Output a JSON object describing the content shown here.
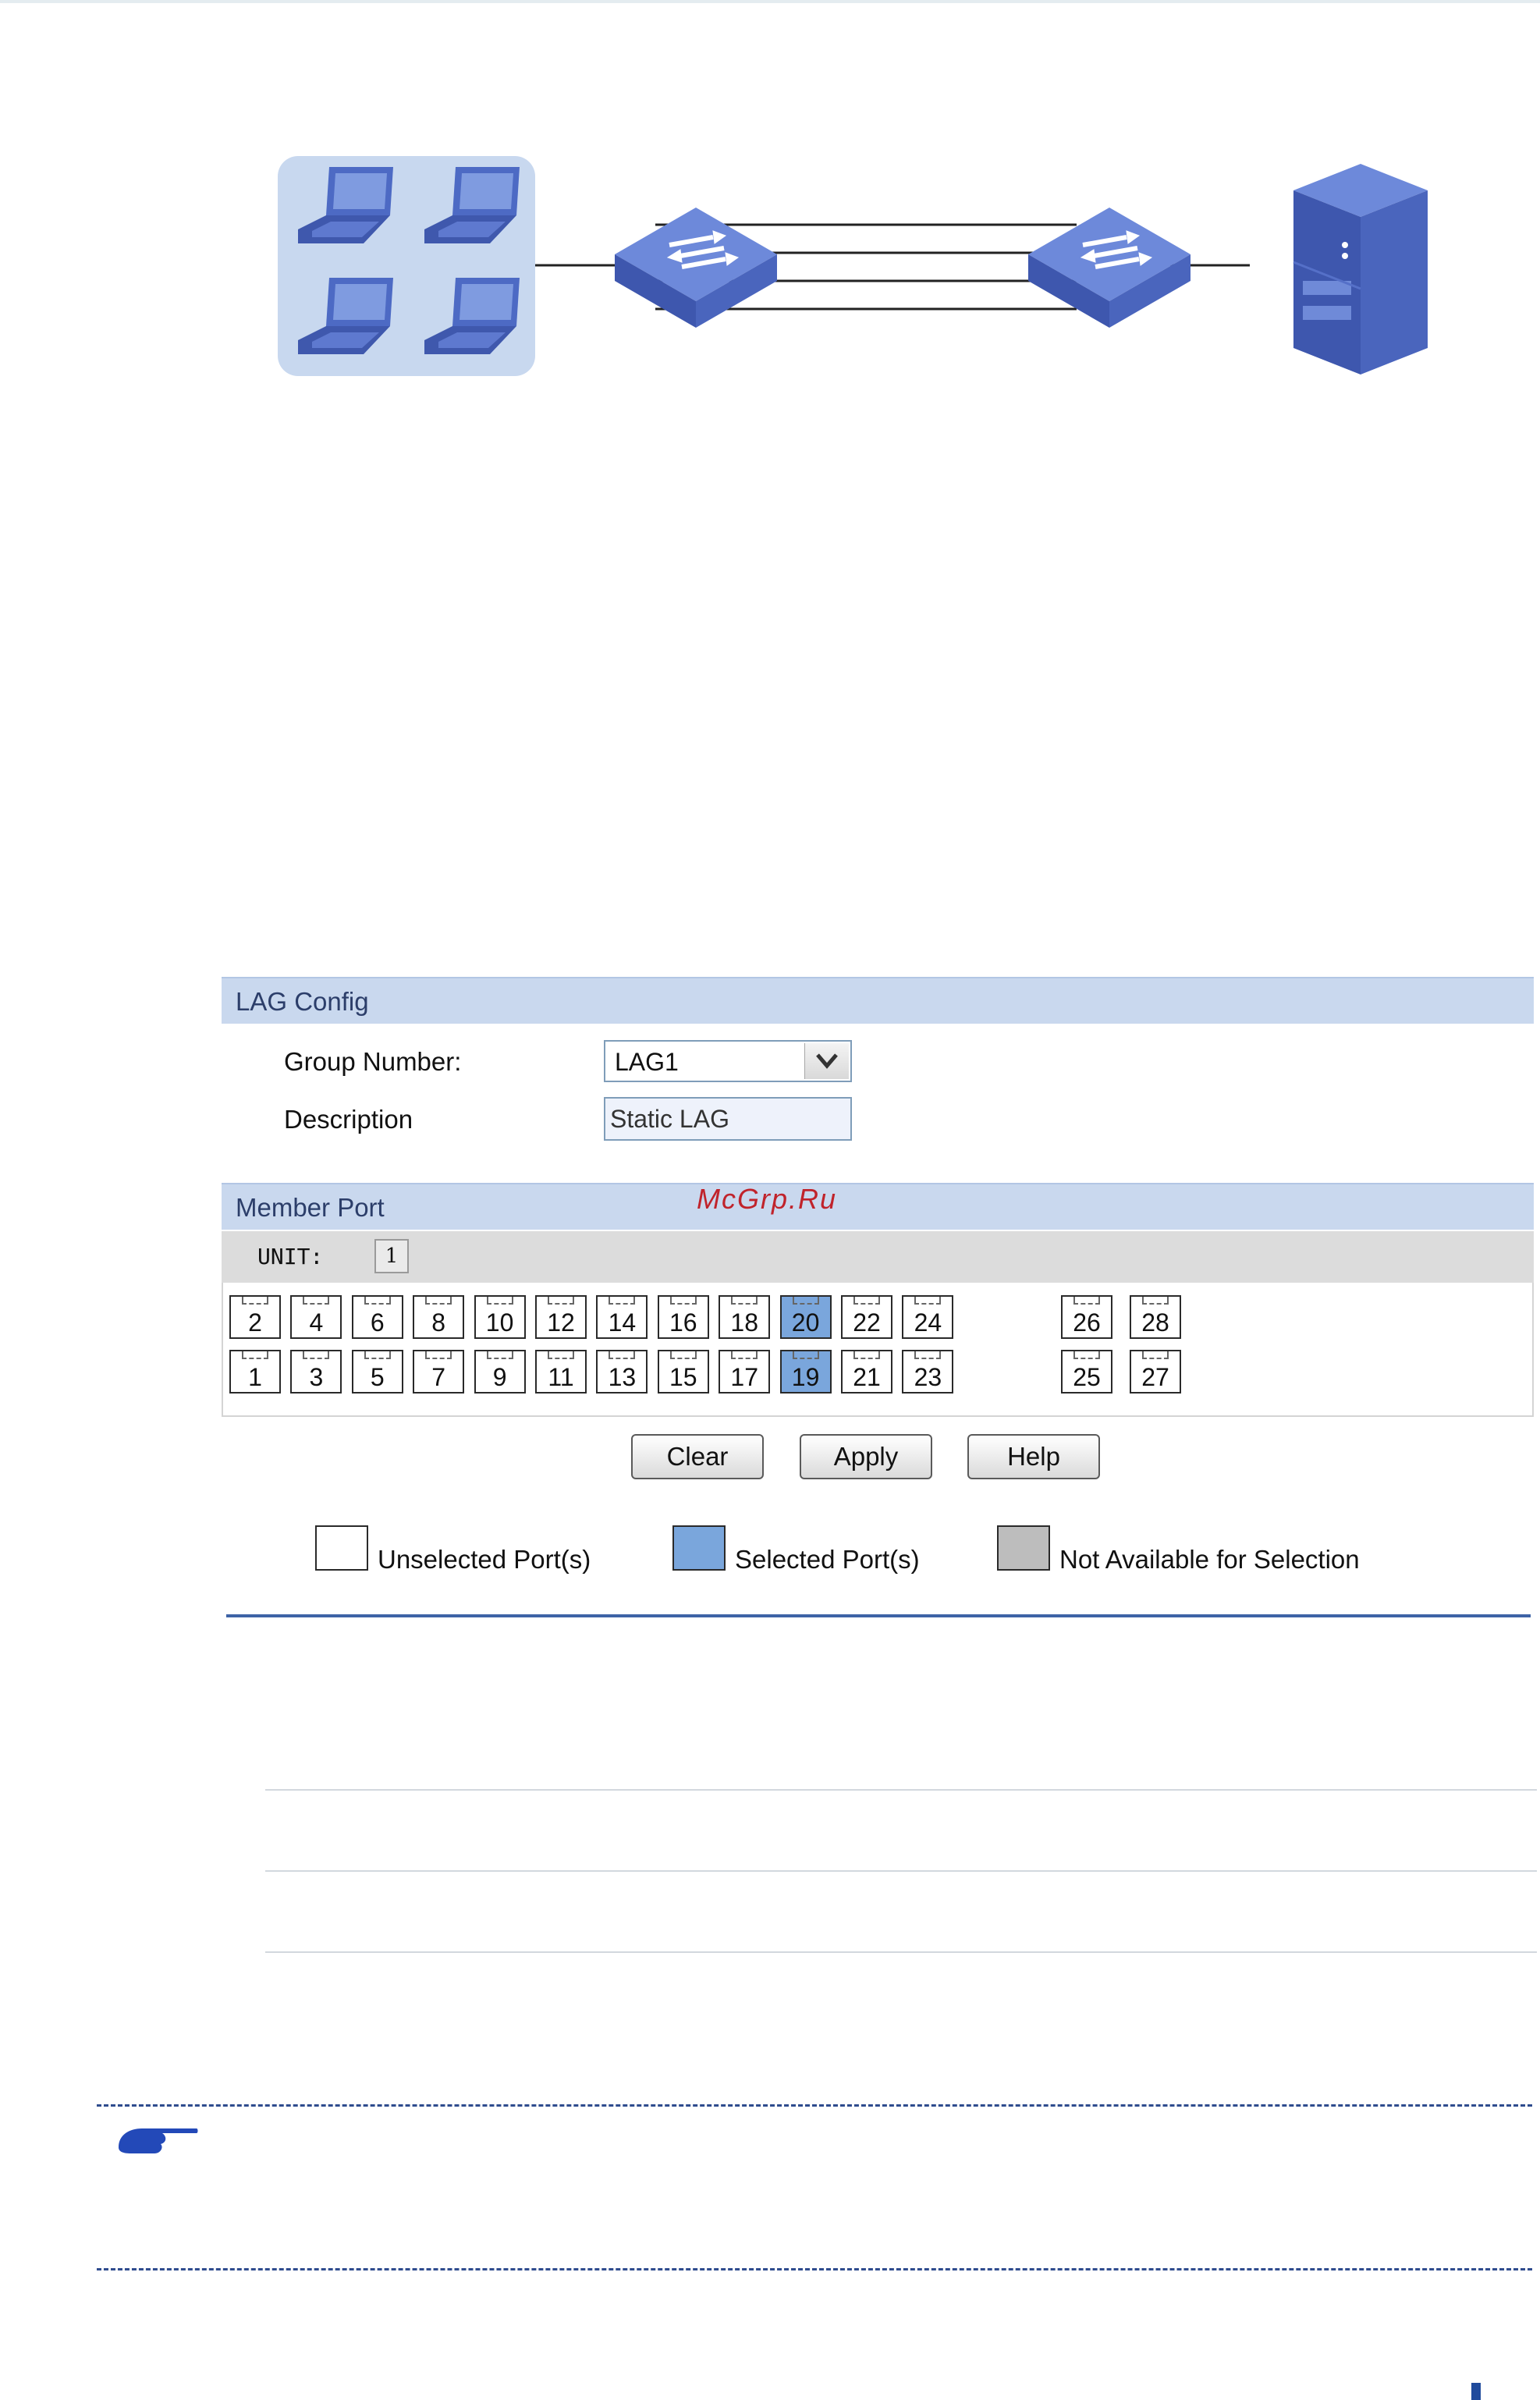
{
  "diagram": {
    "icons": [
      "laptop-icon",
      "laptop-icon",
      "laptop-icon",
      "laptop-icon",
      "switch-icon",
      "switch-icon",
      "server-icon"
    ],
    "link_count": 4
  },
  "lag_config": {
    "title": "LAG Config",
    "group_number_label": "Group Number:",
    "group_number_value": "LAG1",
    "description_label": "Description",
    "description_value": "Static LAG"
  },
  "member_port": {
    "title": "Member Port",
    "unit_label": "UNIT:",
    "unit_value": "1",
    "top_row": [
      "2",
      "4",
      "6",
      "8",
      "10",
      "12",
      "14",
      "16",
      "18",
      "20",
      "22",
      "24",
      "26",
      "28"
    ],
    "bottom_row": [
      "1",
      "3",
      "5",
      "7",
      "9",
      "11",
      "13",
      "15",
      "17",
      "19",
      "21",
      "23",
      "25",
      "27"
    ],
    "selected_ports": [
      "19",
      "20"
    ]
  },
  "buttons": {
    "clear": "Clear",
    "apply": "Apply",
    "help": "Help"
  },
  "legend": {
    "unselected": "Unselected Port(s)",
    "selected": "Selected Port(s)",
    "unavailable": "Not Available for Selection"
  },
  "watermark": "McGrp.Ru",
  "colors": {
    "panel_header": "#c9d8ee",
    "selected_port": "#7aa6dc",
    "unavailable_port": "#bdbdbd",
    "device_blue": "#4d6ac4",
    "host_group_bg": "#c8d8ef"
  }
}
